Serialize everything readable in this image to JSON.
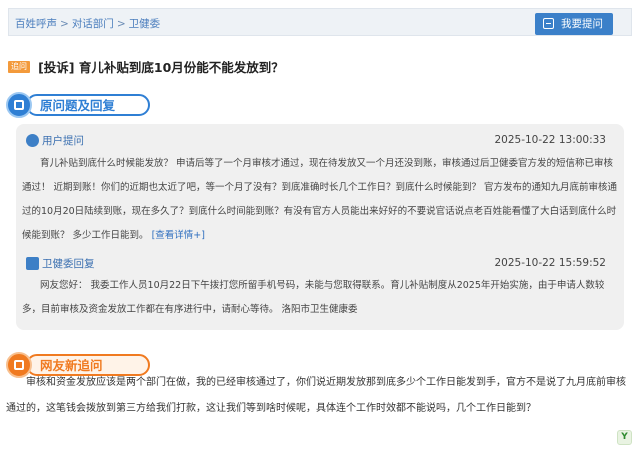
{
  "breadcrumb": {
    "items": [
      "百姓呼声",
      "对话部门",
      "卫健委"
    ],
    "separator": ">"
  },
  "ask_button": {
    "label": "我要提问"
  },
  "post": {
    "tag": "追问",
    "title": "[投诉] 育儿补贴到底10月份能不能发放到？"
  },
  "section_original": {
    "label": "原问题及回复"
  },
  "question": {
    "author": "用户提问",
    "time": "2025-10-22 13:00:33",
    "text": "育儿补贴到底什么时候能发放？ 申请后等了一个月审核才通过，现在待发放又一个月还没到账，审核通过后卫健委官方发的短信称已审核通过！ 近期到账！你们的近期也太近了吧，等一个月了没有？到底准确时长几个工作日？到底什么时候能到？ 官方发布的通知九月底前审核通过的10月20日陆续到账，现在多久了？到底什么时间能到账？有没有官方人员能出来好好的不要说官话说点老百姓能看懂了大白话到底什么时候能到账？ 多少工作日能到。",
    "more_link": "[查看详情+]"
  },
  "reply": {
    "author": "卫健委回复",
    "time": "2025-10-22 15:59:52",
    "text": "网友您好： 我委工作人员10月22日下午拨打您所留手机号码，未能与您取得联系。育儿补贴制度从2025年开始实施，由于申请人数较多，目前审核及资金发放工作都在有序进行中，请耐心等待。 洛阳市卫生健康委"
  },
  "section_followup": {
    "label": "网友新追问"
  },
  "followup": {
    "text": "审核和资金发放应该是两个部门在做，我的已经审核通过了，你们说近期发放那到底多少个工作日能发到手，官方不是说了九月底前审核通过的，这笔钱会拨放到第三方给我们打款，这让我们等到啥时候呢，具体连个工作时效都不能说吗，几个工作日能到？"
  },
  "colors": {
    "accent_blue": "#2f7fd4",
    "accent_orange": "#f07a20",
    "tag_orange": "#f39a3b"
  },
  "icons": [
    "ask-icon",
    "user-icon",
    "department-icon",
    "brand-icon"
  ]
}
